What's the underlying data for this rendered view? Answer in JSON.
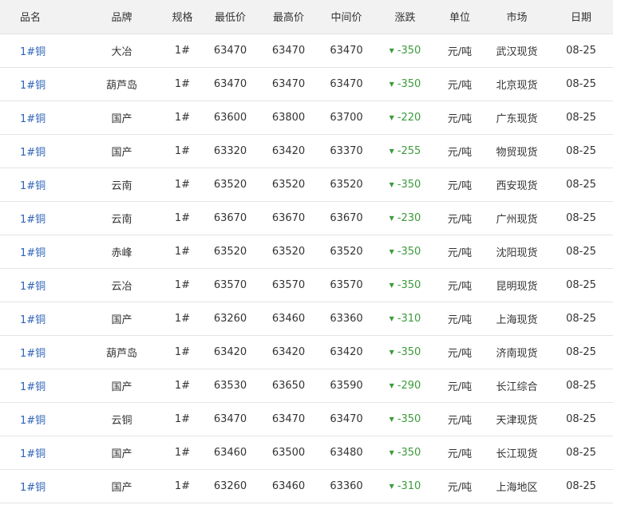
{
  "columns": {
    "name": "品名",
    "brand": "品牌",
    "spec": "规格",
    "low": "最低价",
    "high": "最高价",
    "mid": "中间价",
    "change": "涨跌",
    "unit": "单位",
    "market": "市场",
    "date": "日期"
  },
  "colors": {
    "link": "#2f64b8",
    "down": "#3c9a3c",
    "header_bg": "#f2f2f2"
  },
  "down_arrow_icon": "▼",
  "rows": [
    {
      "name": "1#铜",
      "brand": "大冶",
      "spec": "1#",
      "low": "63470",
      "high": "63470",
      "mid": "63470",
      "change": "-350",
      "unit": "元/吨",
      "market": "武汉现货",
      "date": "08-25"
    },
    {
      "name": "1#铜",
      "brand": "葫芦岛",
      "spec": "1#",
      "low": "63470",
      "high": "63470",
      "mid": "63470",
      "change": "-350",
      "unit": "元/吨",
      "market": "北京现货",
      "date": "08-25"
    },
    {
      "name": "1#铜",
      "brand": "国产",
      "spec": "1#",
      "low": "63600",
      "high": "63800",
      "mid": "63700",
      "change": "-220",
      "unit": "元/吨",
      "market": "广东现货",
      "date": "08-25"
    },
    {
      "name": "1#铜",
      "brand": "国产",
      "spec": "1#",
      "low": "63320",
      "high": "63420",
      "mid": "63370",
      "change": "-255",
      "unit": "元/吨",
      "market": "物贸现货",
      "date": "08-25"
    },
    {
      "name": "1#铜",
      "brand": "云南",
      "spec": "1#",
      "low": "63520",
      "high": "63520",
      "mid": "63520",
      "change": "-350",
      "unit": "元/吨",
      "market": "西安现货",
      "date": "08-25"
    },
    {
      "name": "1#铜",
      "brand": "云南",
      "spec": "1#",
      "low": "63670",
      "high": "63670",
      "mid": "63670",
      "change": "-230",
      "unit": "元/吨",
      "market": "广州现货",
      "date": "08-25"
    },
    {
      "name": "1#铜",
      "brand": "赤峰",
      "spec": "1#",
      "low": "63520",
      "high": "63520",
      "mid": "63520",
      "change": "-350",
      "unit": "元/吨",
      "market": "沈阳现货",
      "date": "08-25"
    },
    {
      "name": "1#铜",
      "brand": "云冶",
      "spec": "1#",
      "low": "63570",
      "high": "63570",
      "mid": "63570",
      "change": "-350",
      "unit": "元/吨",
      "market": "昆明现货",
      "date": "08-25"
    },
    {
      "name": "1#铜",
      "brand": "国产",
      "spec": "1#",
      "low": "63260",
      "high": "63460",
      "mid": "63360",
      "change": "-310",
      "unit": "元/吨",
      "market": "上海现货",
      "date": "08-25"
    },
    {
      "name": "1#铜",
      "brand": "葫芦岛",
      "spec": "1#",
      "low": "63420",
      "high": "63420",
      "mid": "63420",
      "change": "-350",
      "unit": "元/吨",
      "market": "济南现货",
      "date": "08-25"
    },
    {
      "name": "1#铜",
      "brand": "国产",
      "spec": "1#",
      "low": "63530",
      "high": "63650",
      "mid": "63590",
      "change": "-290",
      "unit": "元/吨",
      "market": "长江综合",
      "date": "08-25"
    },
    {
      "name": "1#铜",
      "brand": "云铜",
      "spec": "1#",
      "low": "63470",
      "high": "63470",
      "mid": "63470",
      "change": "-350",
      "unit": "元/吨",
      "market": "天津现货",
      "date": "08-25"
    },
    {
      "name": "1#铜",
      "brand": "国产",
      "spec": "1#",
      "low": "63460",
      "high": "63500",
      "mid": "63480",
      "change": "-350",
      "unit": "元/吨",
      "market": "长江现货",
      "date": "08-25"
    },
    {
      "name": "1#铜",
      "brand": "国产",
      "spec": "1#",
      "low": "63260",
      "high": "63460",
      "mid": "63360",
      "change": "-310",
      "unit": "元/吨",
      "market": "上海地区",
      "date": "08-25"
    }
  ]
}
